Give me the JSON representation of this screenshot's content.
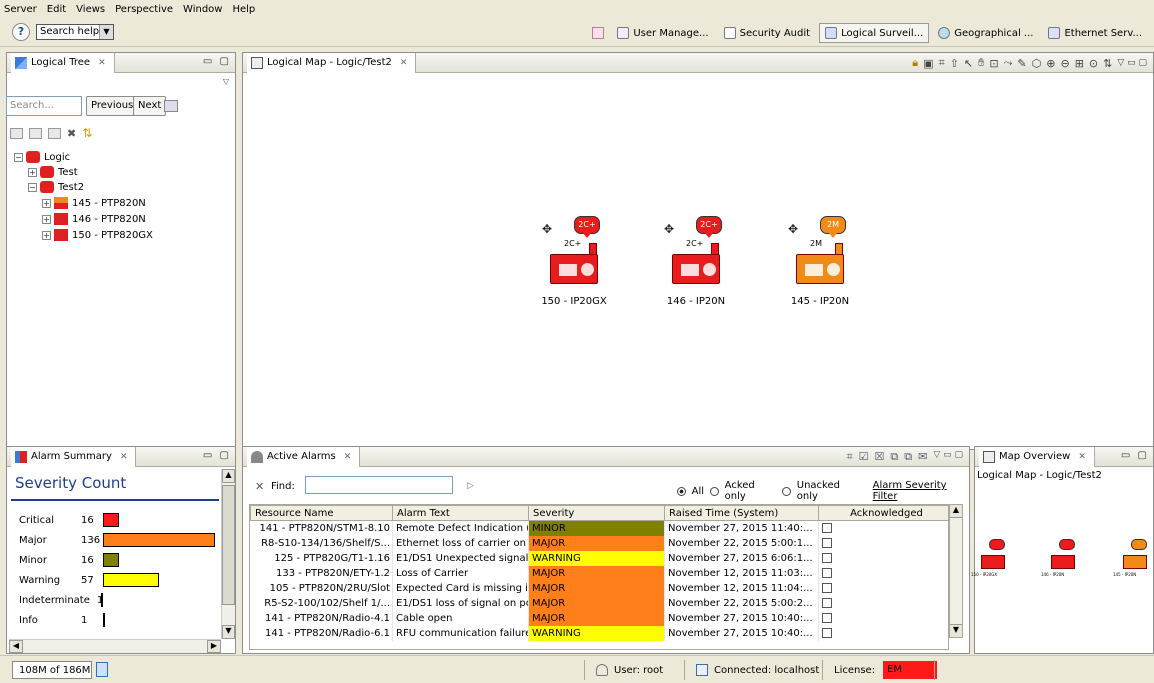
{
  "menu": [
    "Server",
    "Edit",
    "Views",
    "Perspective",
    "Window",
    "Help"
  ],
  "toolbar": {
    "search_help": "Search help"
  },
  "perspectives": [
    {
      "label": "User Manage...",
      "active": false
    },
    {
      "label": "Security Audit",
      "active": false
    },
    {
      "label": "Logical Surveil...",
      "active": true
    },
    {
      "label": "Geographical ...",
      "active": false
    },
    {
      "label": "Ethernet Serv...",
      "active": false
    }
  ],
  "logical_tree": {
    "tab": "Logical Tree",
    "search_placeholder": "Search...",
    "previous": "Previous",
    "next": "Next",
    "nodes": [
      {
        "label": "Logic",
        "expanded": true
      },
      {
        "label": "Test",
        "expanded": false
      },
      {
        "label": "Test2",
        "expanded": true
      },
      {
        "label": "145 - PTP820N",
        "expanded": false
      },
      {
        "label": "146 - PTP820N",
        "expanded": false
      },
      {
        "label": "150 - PTP820GX",
        "expanded": false
      }
    ]
  },
  "map": {
    "tab": "Logical Map - Logic/Test2",
    "nodes": [
      {
        "label": "150 - IP20GX",
        "badge": "2C+",
        "sub": "2C+",
        "color": "#e81c1c"
      },
      {
        "label": "146 - IP20N",
        "badge": "2C+",
        "sub": "2C+",
        "color": "#e81c1c"
      },
      {
        "label": "145 - IP20N",
        "badge": "2M",
        "sub": "2M",
        "color": "#f28a1a"
      }
    ]
  },
  "alarm_summary": {
    "tab": "Alarm Summary",
    "title": "Severity Count",
    "rows": [
      {
        "name": "Critical",
        "count": "16",
        "value": 16,
        "color": "#ff1a1a"
      },
      {
        "name": "Major",
        "count": "136",
        "value": 136,
        "color": "#ff7f1a"
      },
      {
        "name": "Minor",
        "count": "16",
        "value": 16,
        "color": "#808000"
      },
      {
        "name": "Warning",
        "count": "57",
        "value": 57,
        "color": "#ffff00"
      },
      {
        "name": "Indeterminate",
        "count": "1",
        "value": 1,
        "color": "#000000"
      },
      {
        "name": "Info",
        "count": "1",
        "value": 1,
        "color": "#000000"
      }
    ]
  },
  "active_alarms": {
    "tab": "Active Alarms",
    "find_label": "Find:",
    "filter_all": "All",
    "filter_acked": "Acked only",
    "filter_unacked": "Unacked only",
    "severity_filter": "Alarm Severity Filter",
    "columns": [
      "Resource Name",
      "Alarm Text",
      "Severity",
      "Raised Time (System)",
      "Acknowledged"
    ],
    "rows": [
      {
        "resource": "141 - PTP820N/STM1-8.10",
        "text": "Remote Defect Indication (...",
        "severity": "MINOR",
        "color": "#808000",
        "time": "November 27, 2015 11:40:..."
      },
      {
        "resource": "R8-S10-134/136/Shelf/S...",
        "text": "Ethernet loss of carrier on ...",
        "severity": "MAJOR",
        "color": "#ff7f1a",
        "time": "November 22, 2015 5:00:1..."
      },
      {
        "resource": "125 - PTP820G/T1-1.16",
        "text": "E1/DS1 Unexpected signal ...",
        "severity": "WARNING",
        "color": "#ffff00",
        "time": "November 27, 2015 6:06:1..."
      },
      {
        "resource": "133 - PTP820N/ETY-1.2",
        "text": "Loss of Carrier",
        "severity": "MAJOR",
        "color": "#ff7f1a",
        "time": "November 12, 2015 11:03:..."
      },
      {
        "resource": "105 - PTP820N/2RU/Slot",
        "text": "Expected Card is missing in...",
        "severity": "MAJOR",
        "color": "#ff7f1a",
        "time": "November 12, 2015 11:04:..."
      },
      {
        "resource": "R5-S2-100/102/Shelf 1/...",
        "text": "E1/DS1 loss of signal on po...",
        "severity": "MAJOR",
        "color": "#ff7f1a",
        "time": "November 22, 2015 5:00:2..."
      },
      {
        "resource": "141 - PTP820N/Radio-4.1",
        "text": "Cable open",
        "severity": "MAJOR",
        "color": "#ff7f1a",
        "time": "November 27, 2015 10:40:..."
      },
      {
        "resource": "141 - PTP820N/Radio-6.1",
        "text": "RFU communication failure",
        "severity": "WARNING",
        "color": "#ffff00",
        "time": "November 27, 2015 10:40:..."
      }
    ]
  },
  "map_overview": {
    "tab": "Map Overview",
    "title": "Logical Map - Logic/Test2",
    "labels": [
      "150 - IP20GX",
      "146 - IP20N",
      "145 - IP20N"
    ]
  },
  "status": {
    "memory": "108M of 186M",
    "user": "User: root",
    "connection": "Connected: localhost",
    "license_label": "License:",
    "license_value": "EM"
  }
}
